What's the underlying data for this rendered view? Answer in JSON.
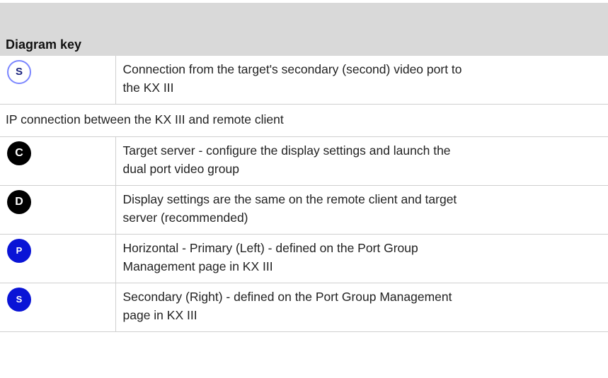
{
  "table": {
    "heading": "Diagram key",
    "rows": [
      {
        "icon_name": "s-outline-circle-icon",
        "icon_letter": "S",
        "description_line1": "Connection from the target's secondary (second) video port to",
        "description_line2": "the KX III"
      },
      {
        "description": "IP connection between the KX III and remote client"
      },
      {
        "icon_name": "c-black-circle-icon",
        "icon_letter": "C",
        "description_line1": "Target server - configure the display settings and launch the",
        "description_line2": "dual port video group"
      },
      {
        "icon_name": "d-black-circle-icon",
        "icon_letter": "D",
        "description_line1": "Display settings are the same on the remote client and target",
        "description_line2": "server (recommended)"
      },
      {
        "icon_name": "p-blue-circle-icon",
        "icon_letter": "P",
        "description_line1": "Horizontal - Primary (Left) - defined on the Port Group",
        "description_line2": "Management page in KX III"
      },
      {
        "icon_name": "s-blue-circle-icon",
        "icon_letter": "S",
        "description_line1": "Secondary (Right) - defined on the Port Group Management",
        "description_line2": "page in KX III"
      }
    ]
  }
}
